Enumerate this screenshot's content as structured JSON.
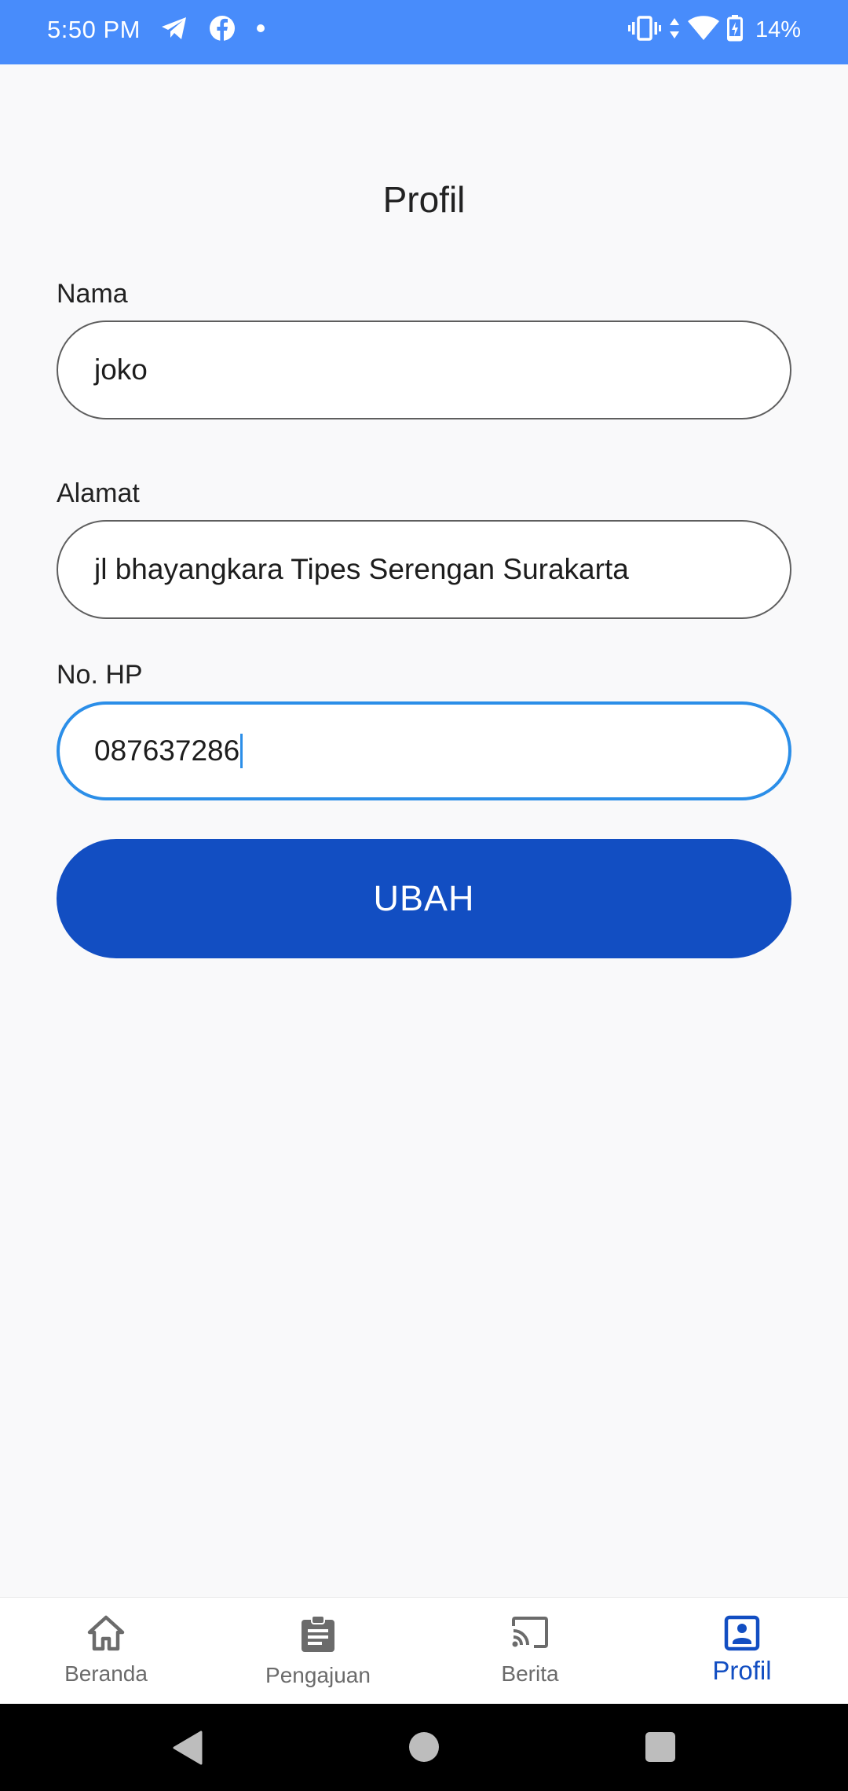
{
  "status_bar": {
    "time": "5:50 PM",
    "battery_percent": "14%",
    "icons": [
      "telegram-icon",
      "facebook-icon",
      "dot-icon",
      "vibrate-icon",
      "data-arrows-icon",
      "wifi-icon",
      "battery-charging-icon"
    ]
  },
  "page": {
    "title": "Profil"
  },
  "form": {
    "nama": {
      "label": "Nama",
      "value": "joko"
    },
    "alamat": {
      "label": "Alamat",
      "value": "jl bhayangkara Tipes Serengan Surakarta"
    },
    "no_hp": {
      "label": "No. HP",
      "value": "087637286"
    },
    "submit_label": "UBAH"
  },
  "bottom_nav": {
    "items": [
      {
        "label": "Beranda",
        "icon": "home-icon"
      },
      {
        "label": "Pengajuan",
        "icon": "clipboard-icon"
      },
      {
        "label": "Berita",
        "icon": "cast-icon"
      },
      {
        "label": "Profil",
        "icon": "profile-card-icon"
      }
    ],
    "active_index": 3
  },
  "colors": {
    "status_bar": "#488cfb",
    "primary": "#124ec2",
    "focus": "#2b8ee8",
    "background": "#f9f9fa"
  }
}
